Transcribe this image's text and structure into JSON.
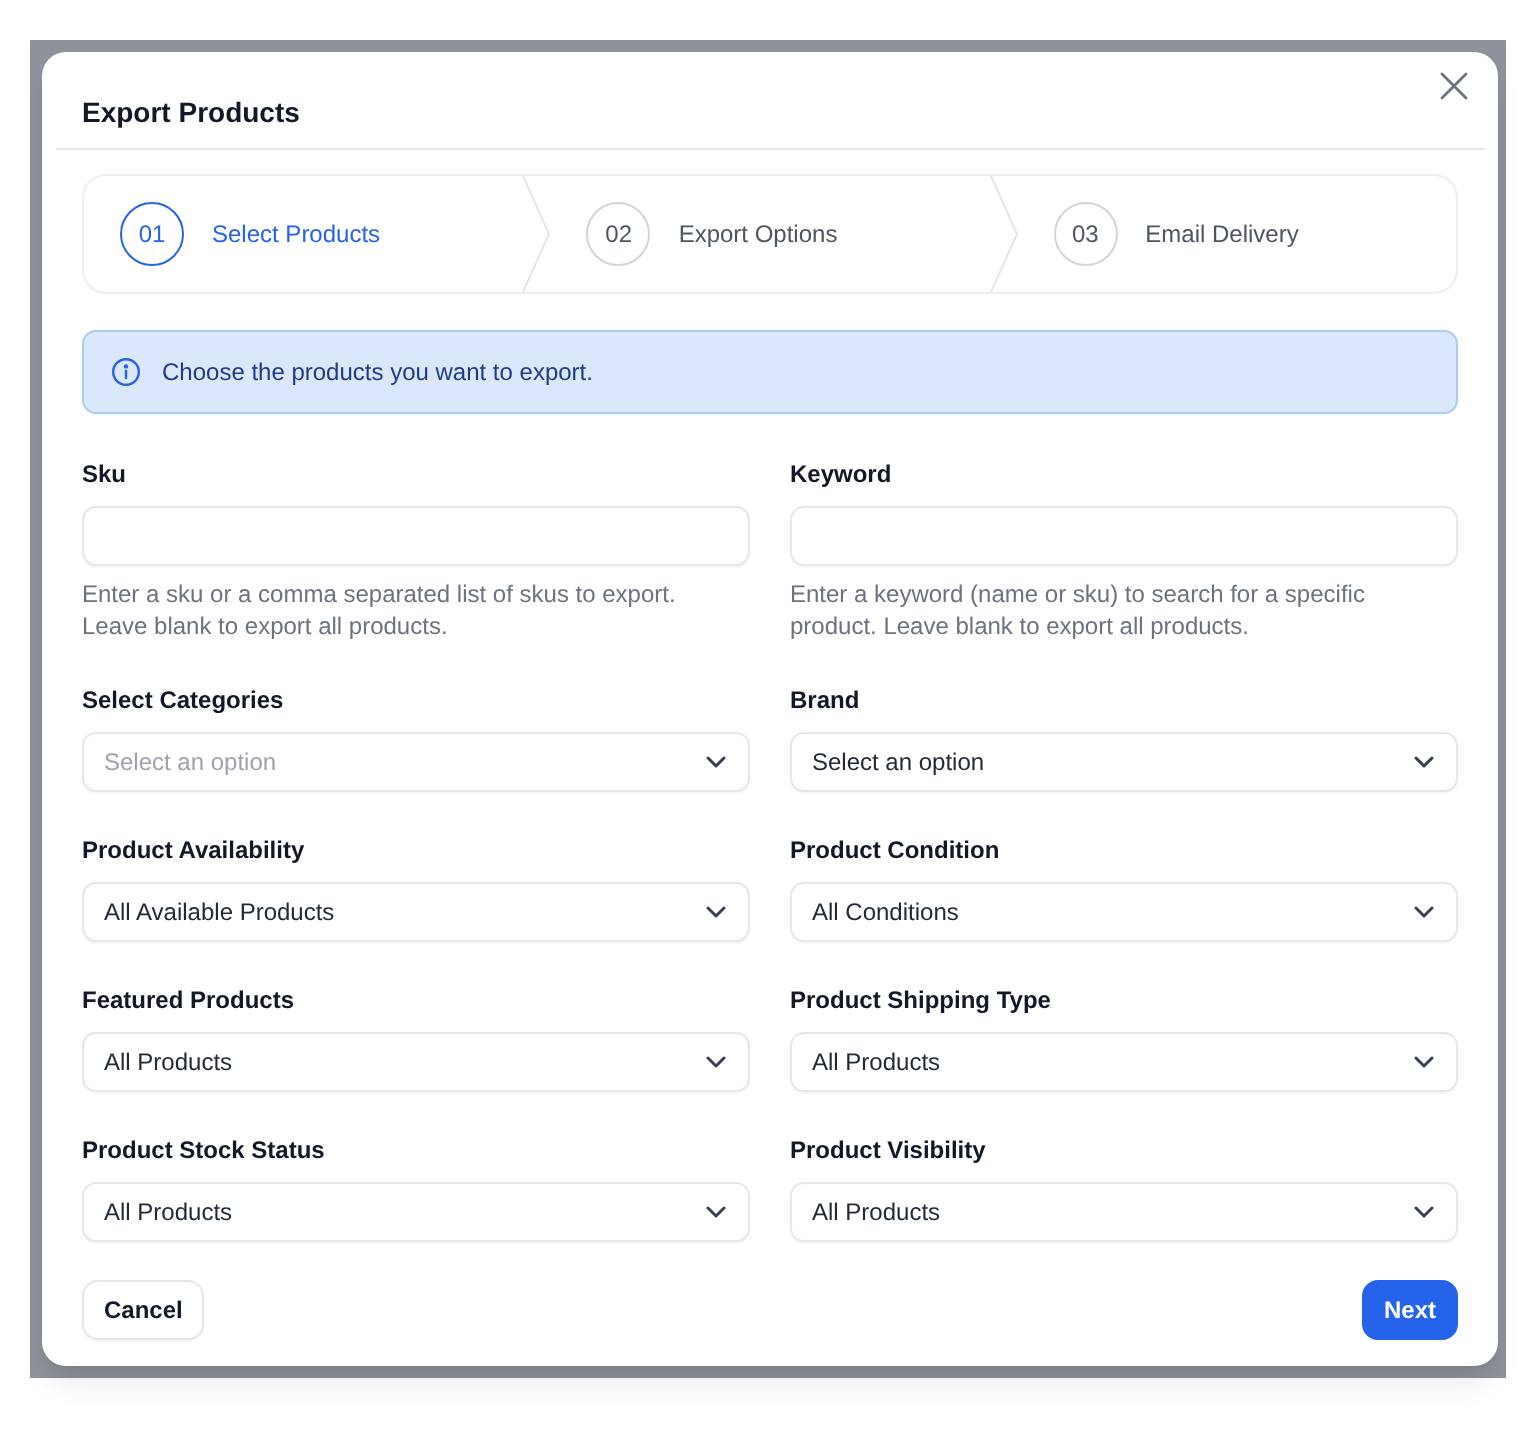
{
  "dialog": {
    "title": "Export Products"
  },
  "steps": [
    {
      "number": "01",
      "label": "Select Products",
      "selected": true
    },
    {
      "number": "02",
      "label": "Export Options",
      "selected": false
    },
    {
      "number": "03",
      "label": "Email Delivery",
      "selected": false
    }
  ],
  "alert": {
    "message": "Choose the products you want to export."
  },
  "fields": [
    {
      "kind": "text",
      "label": "Sku",
      "help": "Enter a sku or a comma separated list of skus to export. Leave blank to export all products."
    },
    {
      "kind": "text",
      "label": "Keyword",
      "help": "Enter a keyword (name or sku) to search for a specific product. Leave blank to export all products."
    },
    {
      "kind": "select",
      "label": "Select Categories",
      "placeholder": "Select an option"
    },
    {
      "kind": "select",
      "label": "Brand",
      "value": "Select an option"
    },
    {
      "kind": "select",
      "label": "Product Availability",
      "value": "All Available Products"
    },
    {
      "kind": "select",
      "label": "Product Condition",
      "value": "All Conditions"
    },
    {
      "kind": "select",
      "label": "Featured Products",
      "value": "All Products"
    },
    {
      "kind": "select",
      "label": "Product Shipping Type",
      "value": "All Products"
    },
    {
      "kind": "select",
      "label": "Product Stock Status",
      "value": "All Products"
    },
    {
      "kind": "select",
      "label": "Product Visibility",
      "value": "All Products"
    }
  ],
  "buttons": [
    {
      "kind": "secondary",
      "label": "Cancel"
    },
    {
      "kind": "primary",
      "label": "Next"
    }
  ]
}
